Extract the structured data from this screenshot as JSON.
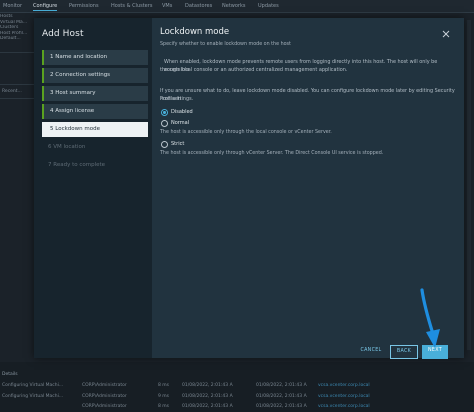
{
  "background": {
    "tabs": [
      "Monitor",
      "Configure",
      "Permissions",
      "Hosts & Clusters",
      "VMs",
      "Datastores",
      "Networks",
      "Updates"
    ],
    "active_tab": "Configure",
    "side_labels": [
      "Hosts",
      "Virtual Ma...",
      "Clusters",
      "Host Profil...",
      "Default..."
    ],
    "left_label": "Recent...",
    "details_label": "Details",
    "rows": [
      {
        "task": "Configuring Virtual Machi...",
        "initiator": "CORP\\Administrator",
        "queued": "8 ms",
        "start": "01/08/2022, 2:01:43 A",
        "complete": "01/08/2022, 2:01:43 A",
        "server": "vcsa.vcenter.corp.local"
      },
      {
        "task": "Configuring Virtual Machi...",
        "initiator": "CORP\\Administrator",
        "queued": "9 ms",
        "start": "01/08/2022, 2:01:43 A",
        "complete": "01/08/2022, 2:01:43 A",
        "server": "vcsa.vcenter.corp.local"
      },
      {
        "task": "",
        "initiator": "CORP\\Administrator",
        "queued": "8 ms",
        "start": "01/08/2022, 2:01:43 A",
        "complete": "01/08/2022, 2:01:43 A",
        "server": "vcsa.vcenter.corp.local"
      }
    ]
  },
  "wizard": {
    "title": "Add Host",
    "steps": [
      {
        "label": "1  Name and location",
        "state": "done"
      },
      {
        "label": "2  Connection settings",
        "state": "done"
      },
      {
        "label": "3  Host summary",
        "state": "done"
      },
      {
        "label": "4  Assign license",
        "state": "done"
      },
      {
        "label": "5  Lockdown mode",
        "state": "current"
      },
      {
        "label": "6  VM location",
        "state": "future"
      },
      {
        "label": "7  Ready to complete",
        "state": "future"
      }
    ],
    "page": {
      "title": "Lockdown mode",
      "subtitle": "Specify whether to enable lockdown mode on the host",
      "para1_line1": "When enabled, lockdown mode prevents remote users from logging directly into this host. The host will only be accessible",
      "para1_line2": "through local console or an authorized centralized management application.",
      "para2_line1": "If you are unsure what to do, leave lockdown mode disabled. You can configure lockdown mode later by editing Security Profile in",
      "para2_line2": "host settings.",
      "options": [
        {
          "label": "Disabled",
          "checked": true,
          "desc": ""
        },
        {
          "label": "Normal",
          "checked": false,
          "desc": "The host is accessible only through the local console or vCenter Server."
        },
        {
          "label": "Strict",
          "checked": false,
          "desc": "The host is accessible only through vCenter Server. The Direct Console UI service is stopped."
        }
      ]
    },
    "buttons": {
      "cancel": "CANCEL",
      "back": "BACK",
      "next": "NEXT"
    }
  },
  "colors": {
    "accent": "#49afd9",
    "step_done_marker": "#5aa220",
    "annotation_arrow": "#1e8ee0",
    "modal_bg": "#21333f",
    "nav_bg": "#17242d"
  },
  "icons": {
    "close": "close-icon",
    "annotation": "annotation-arrow"
  }
}
